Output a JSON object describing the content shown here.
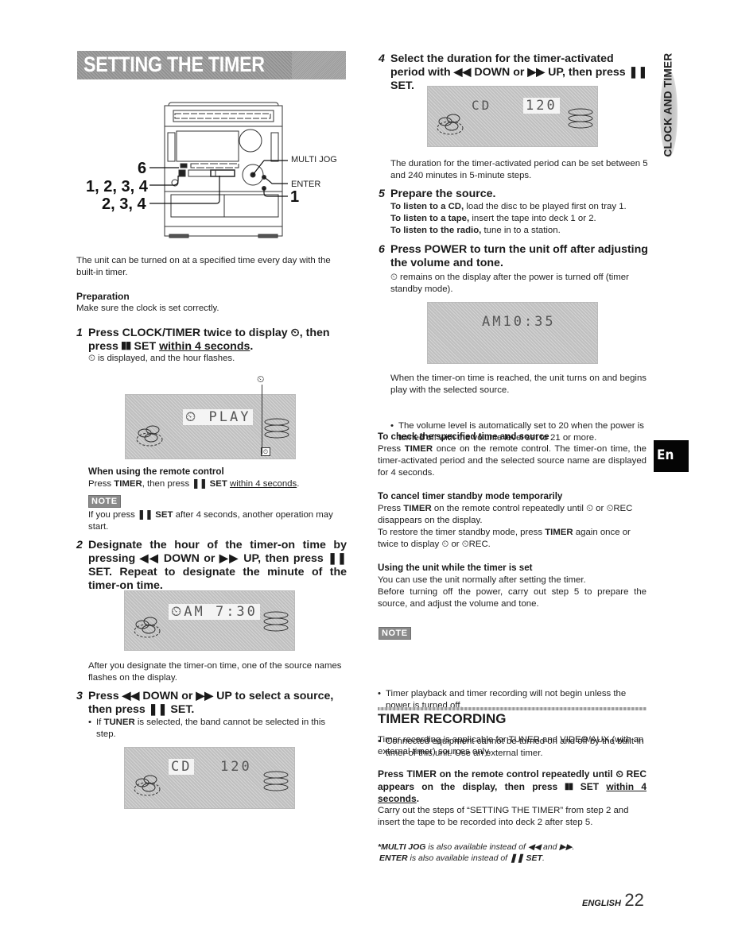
{
  "page": {
    "section_title": "SETTING THE TIMER",
    "side_tab": "CLOCK AND TIMER",
    "language_tab": "En",
    "footer_lang": "ENGLISH",
    "page_number": "22"
  },
  "device_figure": {
    "callouts": {
      "six": "6",
      "one_to_four": "1, 2, 3, 4",
      "two_to_four": "2, 3, 4",
      "one": "1",
      "multi_jog": "MULTI JOG",
      "enter": "ENTER"
    }
  },
  "intro": {
    "text": "The unit can be turned on at a specified time every day with the built-in timer.",
    "preparation_heading": "Preparation",
    "preparation_text": "Make sure the clock is set correctly."
  },
  "steps": [
    {
      "num": "1",
      "heading_a": "Press CLOCK/TIMER twice to display ⏲, then press ❚❚ SET ",
      "heading_u": "within 4 seconds",
      "heading_b": ".",
      "detail": "⏲ is displayed, and the hour flashes.",
      "display": {
        "text": "⏲ PLAY",
        "indicator": "⏲"
      },
      "remote_heading": "When using the remote control",
      "remote_a": "Press ",
      "remote_b": "TIMER",
      "remote_c": ", then press ",
      "remote_d": "❚❚ SET",
      "remote_e": " ",
      "remote_u": "within 4 seconds",
      "remote_f": ".",
      "note_label": "NOTE",
      "note_a": "If you press ",
      "note_b": "❚❚ SET",
      "note_c": " after 4 seconds, another operation may start."
    },
    {
      "num": "2",
      "heading": "Designate the hour of the timer-on time by pressing ◀◀ DOWN or ▶▶ UP, then press ❚❚ SET. Repeat to designate the minute of the timer-on time.",
      "display": {
        "text": "⏲AM 7:30"
      },
      "detail": "After you designate the timer-on time, one of the source names flashes on the display."
    },
    {
      "num": "3",
      "heading": "Press ◀◀ DOWN or ▶▶ UP to select a source, then press ❚❚ SET.",
      "bullet_a": "If ",
      "bullet_b": "TUNER",
      "bullet_c": " is selected, the band cannot be selected in this step.",
      "display": {
        "source": "CD",
        "value": "120"
      }
    },
    {
      "num": "4",
      "heading": "Select the duration for the timer-activated period with ◀◀ DOWN or ▶▶ UP, then press ❚❚ SET.",
      "display": {
        "source": "CD",
        "value": "120"
      },
      "detail": "The duration for the timer-activated period can be set between 5 and 240 minutes in 5-minute steps."
    },
    {
      "num": "5",
      "heading": "Prepare the source.",
      "lines": [
        {
          "bold": "To listen to a CD,",
          "rest": " load the disc to be played first on tray 1."
        },
        {
          "bold": "To listen to a tape,",
          "rest": " insert the tape into deck 1 or 2."
        },
        {
          "bold": "To listen to the radio,",
          "rest": " tune in to a station."
        }
      ]
    },
    {
      "num": "6",
      "heading": "Press POWER to turn the unit off after adjusting the volume and tone.",
      "detail": "⏲ remains on the display after the power is turned off (timer standby mode).",
      "display": {
        "text": "AM10:35"
      },
      "after": "When the timer-on time is reached, the unit turns on and begins play with the selected source.",
      "bullet": "The volume level is automatically set to 20 when the power is turned off with the volume level set to 21 or more."
    }
  ],
  "check": {
    "heading": "To check the specified time and source",
    "a": "Press ",
    "b": "TIMER",
    "c": " once on the remote control. The timer-on time, the timer-activated period and the selected source name are displayed for 4 seconds."
  },
  "cancel": {
    "heading": "To cancel timer standby mode temporarily",
    "a": "Press ",
    "b": "TIMER",
    "c": " on the remote control repeatedly until ⏲ or ⏲REC disappears on the display.",
    "d": "To restore the timer standby mode, press ",
    "e": "TIMER",
    "f": " again once or twice to display ⏲ or ⏲REC."
  },
  "using": {
    "heading": "Using the unit while the timer is set",
    "line1": "You can use the unit normally after setting the timer.",
    "line2": "Before turning off the power, carry out step 5 to prepare the source, and adjust the volume and tone."
  },
  "note2": {
    "label": "NOTE",
    "bullets": [
      "Timer playback and timer recording will not begin unless the power is turned off.",
      "Connected equipment cannot be turned on and off by the built-in timer of this unit.  Use an external timer."
    ]
  },
  "timer_recording": {
    "title": "TIMER RECORDING",
    "intro": "Timer recording is applicable for TUNER and VIDEO/AUX (with an external timer) sources only.",
    "heading_a": "Press TIMER on the remote control repeatedly until ⏲ REC appears on the display, then press ❚❚ SET ",
    "heading_u": "within 4 seconds",
    "heading_b": ".",
    "detail": "Carry out the steps of “SETTING THE TIMER” from step 2 and insert the tape to be recorded into deck 2 after step 5."
  },
  "footnotes": {
    "line1_b": "*MULTI JOG",
    "line1_rest": " is also available instead of ◀◀ and ▶▶.",
    "line2_b": "ENTER",
    "line2_rest": " is also available instead of ",
    "line2_b2": "❚❚ SET",
    "line2_end": "."
  }
}
